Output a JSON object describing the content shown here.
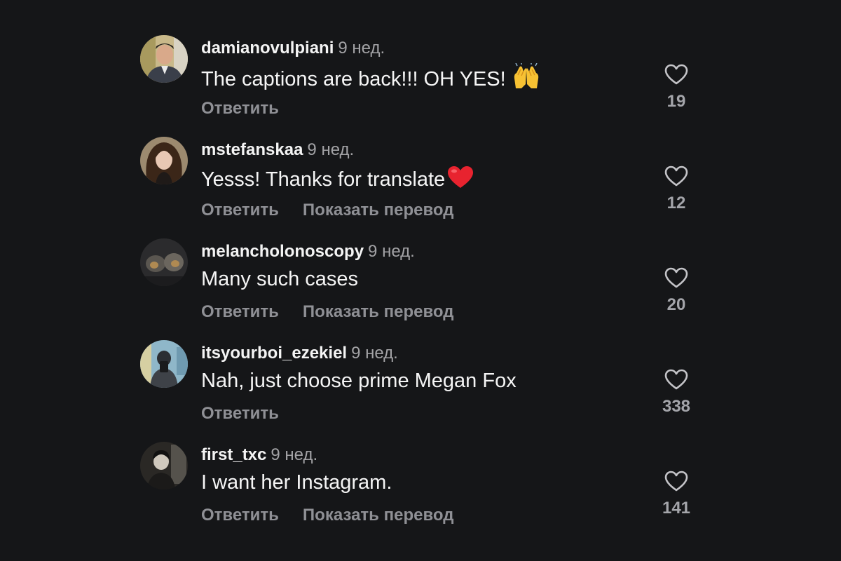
{
  "reply_label": "Ответить",
  "translate_label": "Показать перевод",
  "comments": [
    {
      "username": "damianovulpiani",
      "time": "9 нед.",
      "text": "The captions are back!!! OH YES!",
      "emoji": "raising-hands-emoji",
      "likes": "19"
    },
    {
      "username": "mstefanskaa",
      "time": "9 нед.",
      "text": "Yesss! Thanks for translate",
      "emoji": "red-heart-emoji",
      "likes": "12"
    },
    {
      "username": "melancholonoscopy",
      "time": "9 нед.",
      "text": "Many such cases",
      "likes": "20"
    },
    {
      "username": "itsyourboi_ezekiel",
      "time": "9 нед.",
      "text": "Nah, just choose prime Megan Fox",
      "likes": "338"
    },
    {
      "username": "first_txc",
      "time": "9 нед.",
      "text": "I want her Instagram.",
      "likes": "141"
    }
  ]
}
